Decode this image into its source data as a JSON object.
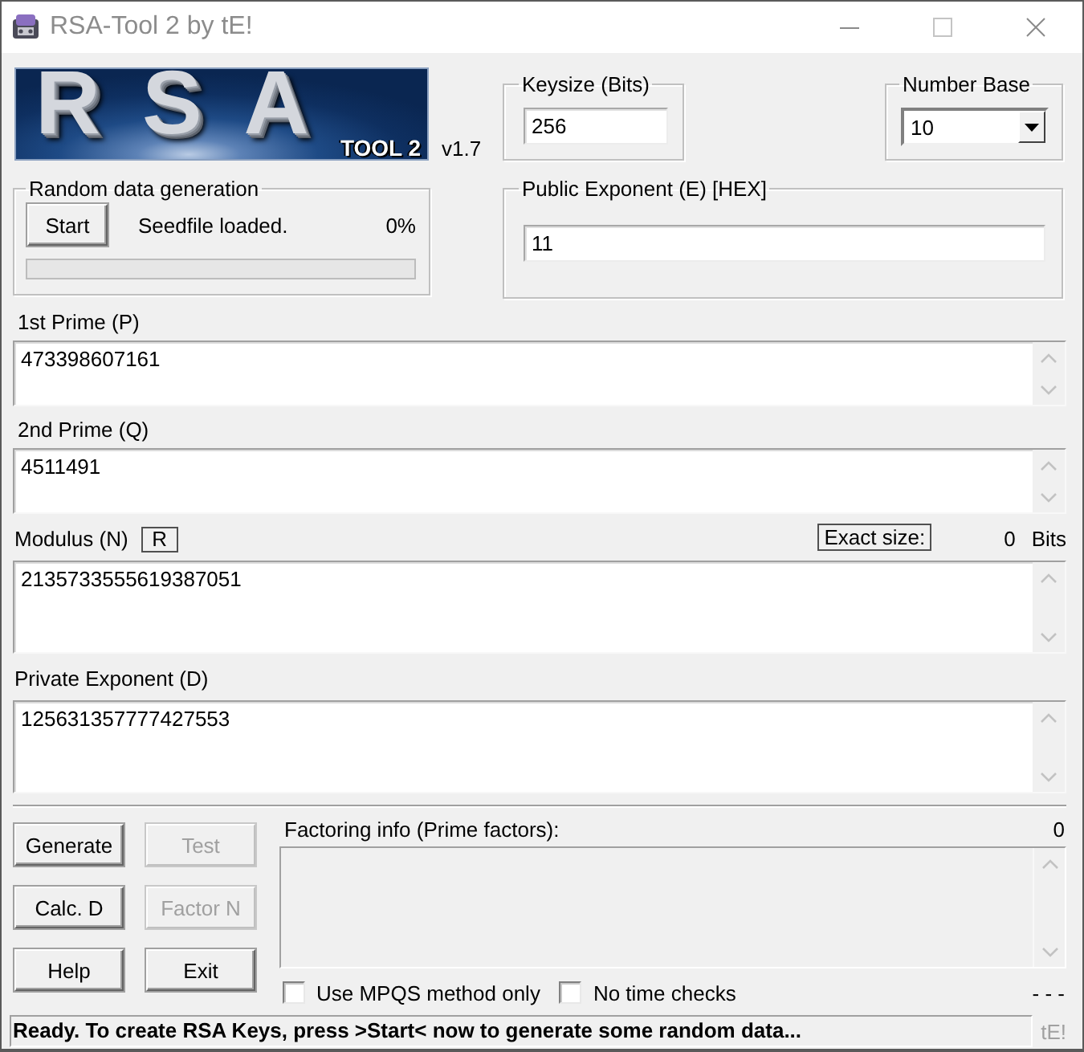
{
  "window": {
    "title": "RSA-Tool 2 by tE!"
  },
  "logo": {
    "title": "RSA",
    "subtitle": "TOOL 2",
    "version": "v1.7"
  },
  "keysize": {
    "label": "Keysize (Bits)",
    "value": "256"
  },
  "number_base": {
    "label": "Number Base",
    "value": "10"
  },
  "random_data": {
    "label": "Random data generation",
    "button": "Start",
    "status": "Seedfile loaded.",
    "percent": "0%",
    "level": 0
  },
  "public_exponent": {
    "label": "Public Exponent (E) [HEX]",
    "value": "11"
  },
  "fields": [
    {
      "kind": "prime",
      "label": "1st Prime (P)",
      "value": "473398607161"
    },
    {
      "kind": "prime",
      "label": "2nd Prime (Q)",
      "value": "4511491"
    },
    {
      "kind": "key",
      "label": "Modulus (N)",
      "value": "2135733555619387051",
      "button": "R",
      "size_label": "Exact size:",
      "size_value": "0",
      "size_unit": "Bits"
    },
    {
      "kind": "key",
      "label": "Private Exponent (D)",
      "value": "125631357777427553"
    }
  ],
  "buttons": [
    {
      "label": "Generate",
      "disabled": false
    },
    {
      "label": "Test",
      "disabled": true
    },
    {
      "label": "Calc. D",
      "disabled": false
    },
    {
      "label": "Factor N",
      "disabled": true
    },
    {
      "label": "Help",
      "disabled": false
    },
    {
      "label": "Exit",
      "disabled": false
    }
  ],
  "factoring": {
    "label": "Factoring info (Prime factors):",
    "count": "0",
    "progress": "- - -"
  },
  "options": [
    {
      "label": "Use MPQS method only",
      "checked": false
    },
    {
      "label": "No time checks",
      "checked": false
    }
  ],
  "status_bar": {
    "text": "Ready. To create RSA Keys, press >Start< now to generate some random data...",
    "signature": "tE!"
  }
}
